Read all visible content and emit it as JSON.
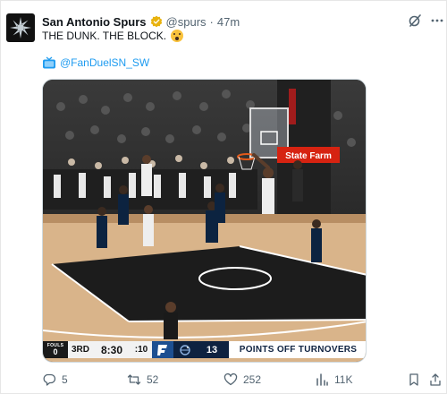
{
  "post": {
    "display_name": "San Antonio Spurs",
    "handle": "@spurs",
    "separator": "·",
    "time": "47m",
    "text": "THE DUNK. THE BLOCK.",
    "emoji": "astonished-face",
    "mention": "@FanDuelSN_SW",
    "verified_color": "#e8b20d"
  },
  "scorebug": {
    "fouls_label": "FOULS",
    "fouls_value": "0",
    "period": "3RD",
    "clock": "8:30",
    "shot_clock": ":10",
    "score": "13",
    "banner": "POINTS OFF TURNOVERS"
  },
  "broadcast": {
    "court_signage": "State Farm"
  },
  "actions": {
    "replies": "5",
    "reposts": "52",
    "likes": "252",
    "views": "11K"
  },
  "colors": {
    "accent": "#1d9bf0",
    "text_secondary": "#536471",
    "scorebug_navy": "#0e2240"
  }
}
